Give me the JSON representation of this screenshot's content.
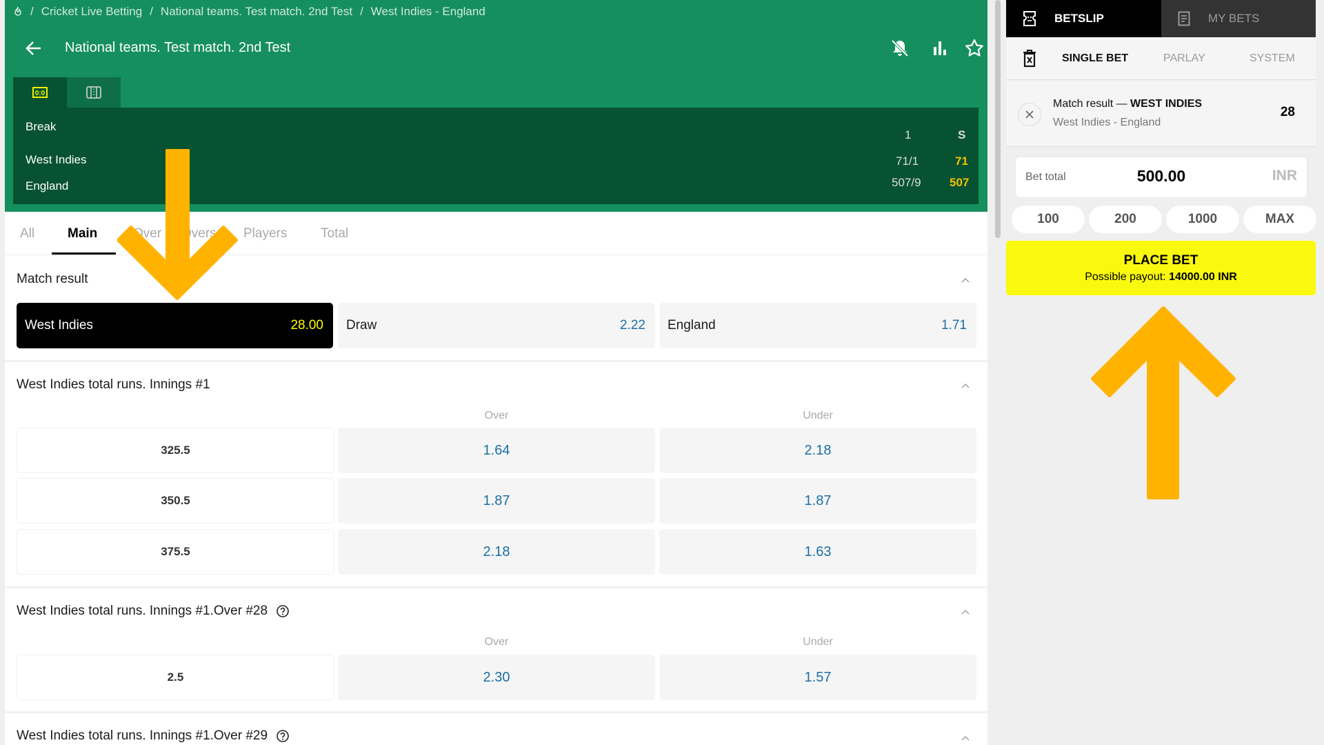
{
  "breadcrumb": {
    "home_icon": "fire-icon",
    "items": [
      "Cricket Live Betting",
      "National teams. Test match. 2nd Test",
      "West Indies - England"
    ]
  },
  "header": {
    "title": "National teams. Test match. 2nd Test",
    "icons": [
      "back-arrow-icon",
      "bell-off-icon",
      "stats-bar-icon",
      "star-icon"
    ]
  },
  "score_tabs": [
    {
      "icon": "scoreboard-icon",
      "active": true
    },
    {
      "icon": "field-icon",
      "active": false
    }
  ],
  "scoreboard": {
    "status": "Break",
    "columns": [
      "1",
      "S"
    ],
    "teams": [
      {
        "name": "West Indies",
        "innings1": "71/1",
        "total": "71"
      },
      {
        "name": "England",
        "innings1": "507/9",
        "total": "507"
      }
    ]
  },
  "market_tabs": [
    {
      "label": "All",
      "active": false
    },
    {
      "label": "Main",
      "active": true
    },
    {
      "label": "Over",
      "active": false
    },
    {
      "label": "Overs",
      "active": false
    },
    {
      "label": "Players",
      "active": false
    },
    {
      "label": "Total",
      "active": false
    }
  ],
  "markets": {
    "match_result": {
      "title": "Match result",
      "outcomes": [
        {
          "name": "West Indies",
          "odds": "28.00",
          "selected": true
        },
        {
          "name": "Draw",
          "odds": "2.22",
          "selected": false
        },
        {
          "name": "England",
          "odds": "1.71",
          "selected": false
        }
      ]
    },
    "wi_innings1": {
      "title": "West Indies total runs. Innings #1",
      "over_label": "Over",
      "under_label": "Under",
      "rows": [
        {
          "line": "325.5",
          "over": "1.64",
          "under": "2.18"
        },
        {
          "line": "350.5",
          "over": "1.87",
          "under": "1.87"
        },
        {
          "line": "375.5",
          "over": "2.18",
          "under": "1.63"
        }
      ]
    },
    "wi_over28": {
      "title": "West Indies total runs. Innings #1.Over #28",
      "over_label": "Over",
      "under_label": "Under",
      "rows": [
        {
          "line": "2.5",
          "over": "2.30",
          "under": "1.57"
        }
      ]
    },
    "wi_over29": {
      "title": "West Indies total runs. Innings #1.Over #29"
    }
  },
  "betslip": {
    "tabs": {
      "betslip": "BETSLIP",
      "my_bets": "MY BETS"
    },
    "bet_types": {
      "single": "SINGLE BET",
      "parlay": "PARLAY",
      "system": "SYSTEM"
    },
    "selection": {
      "market": "Match result — ",
      "pick": "WEST INDIES",
      "event": "West Indies - England",
      "odds": "28"
    },
    "bet_total": {
      "label": "Bet total",
      "amount": "500.00",
      "currency": "INR"
    },
    "quick_amounts": [
      "100",
      "200",
      "1000",
      "MAX"
    ],
    "place_bet": {
      "label": "PLACE BET",
      "payout_label": "Possible payout: ",
      "payout_value": "14000.00 INR"
    }
  },
  "colors": {
    "header_green": "#168f5e",
    "score_dark_green": "#075233",
    "odds_blue": "#1a6fa5",
    "selected_odds_yellow": "#ffff00",
    "place_bet_yellow": "#f9f90f",
    "annotation_arrow": "#ffb300"
  }
}
